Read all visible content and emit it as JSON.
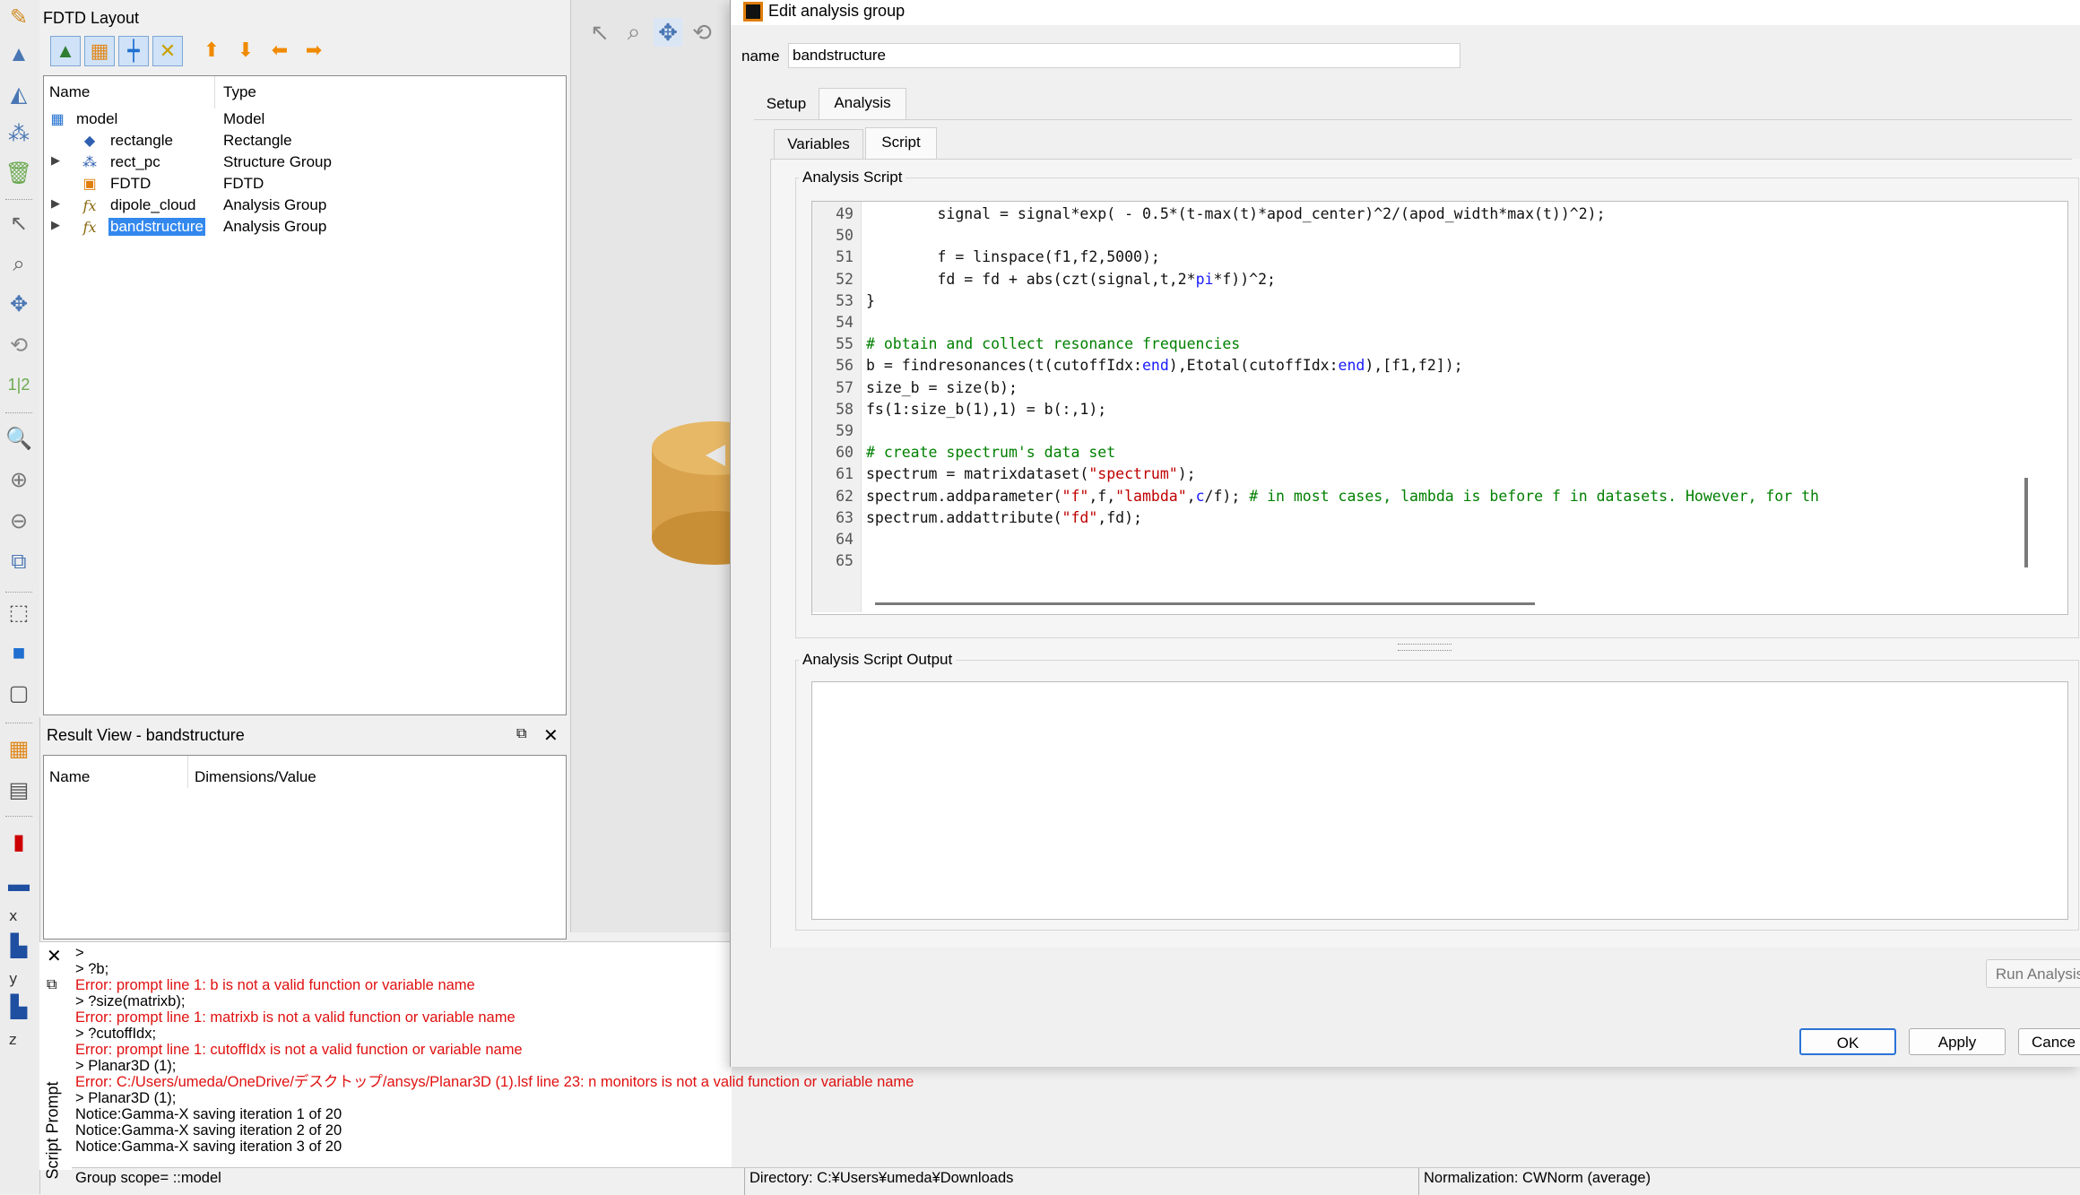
{
  "layout_panel": {
    "title": "FDTD Layout",
    "columns": {
      "name": "Name",
      "type": "Type"
    },
    "tree": [
      {
        "name": "model",
        "type": "Model"
      },
      {
        "name": "rectangle",
        "type": "Rectangle"
      },
      {
        "name": "rect_pc",
        "type": "Structure Group"
      },
      {
        "name": "FDTD",
        "type": "FDTD"
      },
      {
        "name": "dipole_cloud",
        "type": "Analysis Group"
      },
      {
        "name": "bandstructure",
        "type": "Analysis Group"
      }
    ]
  },
  "result_view": {
    "title": "Result View - bandstructure",
    "columns": {
      "name": "Name",
      "value": "Dimensions/Value"
    }
  },
  "left_toolbar": {
    "axis_x": "x",
    "axis_y": "y",
    "axis_z": "z"
  },
  "script_prompt": {
    "label": "Script Prompt",
    "lines": [
      {
        "text": ">",
        "kind": "normal"
      },
      {
        "text": "> ?b;",
        "kind": "normal"
      },
      {
        "text": "Error: prompt line 1: b is not a valid function or variable name",
        "kind": "error"
      },
      {
        "text": "> ?size(matrixb);",
        "kind": "normal"
      },
      {
        "text": "Error: prompt line 1: matrixb is not a valid function or variable name",
        "kind": "error"
      },
      {
        "text": "> ?cutoffIdx;",
        "kind": "normal"
      },
      {
        "text": "Error: prompt line 1: cutoffIdx is not a valid function or variable name",
        "kind": "error"
      },
      {
        "text": "> Planar3D (1);",
        "kind": "normal"
      },
      {
        "text": "Error: C:/Users/umeda/OneDrive/デスクトップ/ansys/Planar3D (1).lsf line 23: n monitors is not a valid function or variable name",
        "kind": "error"
      },
      {
        "text": "> Planar3D (1);",
        "kind": "normal"
      },
      {
        "text": "Notice:Gamma-X saving iteration 1 of 20",
        "kind": "normal"
      },
      {
        "text": "Notice:Gamma-X saving iteration 2 of 20",
        "kind": "normal"
      },
      {
        "text": "Notice:Gamma-X saving iteration 3 of 20",
        "kind": "normal"
      }
    ]
  },
  "status_bar": {
    "scope": "Group scope= ::model",
    "directory": "Directory: C:¥Users¥umeda¥Downloads",
    "normalization": "Normalization: CWNorm (average)"
  },
  "dialog": {
    "title": "Edit analysis group",
    "name_label": "name",
    "name_value": "bandstructure",
    "tabs": {
      "setup": "Setup",
      "analysis": "Analysis"
    },
    "subtabs": {
      "variables": "Variables",
      "script": "Script"
    },
    "script_group_label": "Analysis Script",
    "output_group_label": "Analysis Script Output",
    "run_button": "Run Analysis",
    "ok_button": "OK",
    "apply_button": "Apply",
    "cancel_button": "Cance",
    "code_lines": [
      {
        "ln": "49",
        "parts": [
          [
            "t",
            "        signal = signal*exp( - 0.5*(t-max(t)*apod_center)^2/(apod_width*max(t))^2);"
          ]
        ]
      },
      {
        "ln": "50",
        "parts": []
      },
      {
        "ln": "51",
        "parts": [
          [
            "t",
            "        f = linspace(f1,f2,5000);"
          ]
        ]
      },
      {
        "ln": "52",
        "parts": [
          [
            "t",
            "        fd = fd + abs(czt(signal,t,2*"
          ],
          [
            "kw",
            "pi"
          ],
          [
            "t",
            "*f))^2;"
          ]
        ]
      },
      {
        "ln": "53",
        "parts": [
          [
            "t",
            "}"
          ]
        ]
      },
      {
        "ln": "54",
        "parts": []
      },
      {
        "ln": "55",
        "parts": [
          [
            "cm",
            "# obtain and collect resonance frequencies"
          ]
        ]
      },
      {
        "ln": "56",
        "parts": [
          [
            "t",
            "b = findresonances(t(cutoffIdx:"
          ],
          [
            "kw",
            "end"
          ],
          [
            "t",
            "),Etotal(cutoffIdx:"
          ],
          [
            "kw",
            "end"
          ],
          [
            "t",
            "),[f1,f2]);"
          ]
        ]
      },
      {
        "ln": "57",
        "parts": [
          [
            "t",
            "size_b = size(b);"
          ]
        ]
      },
      {
        "ln": "58",
        "parts": [
          [
            "t",
            "fs(1:size_b(1),1) = b(:,1);"
          ]
        ]
      },
      {
        "ln": "59",
        "parts": []
      },
      {
        "ln": "60",
        "parts": [
          [
            "cm",
            "# create spectrum's data set"
          ]
        ]
      },
      {
        "ln": "61",
        "parts": [
          [
            "t",
            "spectrum = matrixdataset("
          ],
          [
            "str",
            "\"spectrum\""
          ],
          [
            "t",
            ");"
          ]
        ]
      },
      {
        "ln": "62",
        "parts": [
          [
            "t",
            "spectrum.addparameter("
          ],
          [
            "str",
            "\"f\""
          ],
          [
            "t",
            ",f,"
          ],
          [
            "str",
            "\"lambda\""
          ],
          [
            "t",
            ","
          ],
          [
            "kw",
            "c"
          ],
          [
            "t",
            "/f); "
          ],
          [
            "cm",
            "# in most cases, lambda is before f in datasets. However, for th"
          ]
        ]
      },
      {
        "ln": "63",
        "parts": [
          [
            "t",
            "spectrum.addattribute("
          ],
          [
            "str",
            "\"fd\""
          ],
          [
            "t",
            ",fd);"
          ]
        ]
      },
      {
        "ln": "64",
        "parts": []
      },
      {
        "ln": "65",
        "parts": []
      }
    ]
  }
}
